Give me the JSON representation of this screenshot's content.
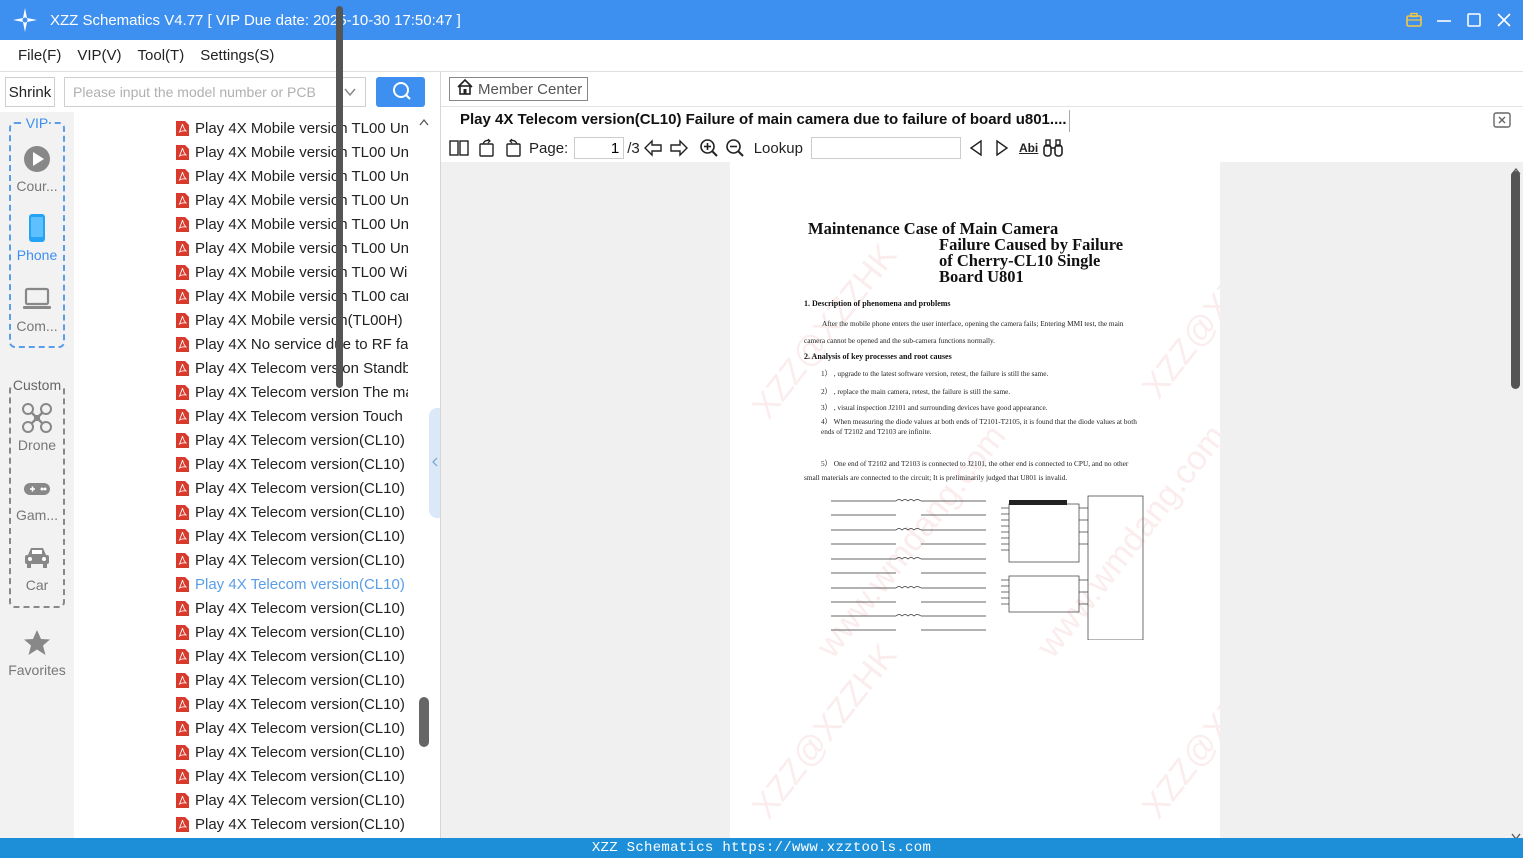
{
  "window": {
    "title": "XZZ Schematics V4.77 [ VIP Due date: 2025-10-30 17:50:47 ]"
  },
  "menu": [
    "File(F)",
    "VIP(V)",
    "Tool(T)",
    "Settings(S)"
  ],
  "toolbar": {
    "shrink_label": "Shrink",
    "search_placeholder": "Please input the model number or PCB"
  },
  "categories": {
    "vip_label": "VIP",
    "custom_label": "Custom",
    "items": [
      {
        "label": "Cour...",
        "icon": "play-circle-icon"
      },
      {
        "label": "Phone",
        "icon": "phone-icon",
        "active": true
      },
      {
        "label": "Com...",
        "icon": "laptop-icon"
      },
      {
        "label": "Drone",
        "icon": "drone-icon"
      },
      {
        "label": "Gam...",
        "icon": "gamepad-icon"
      },
      {
        "label": "Car",
        "icon": "car-icon"
      },
      {
        "label": "Favorites",
        "icon": "star-icon"
      }
    ]
  },
  "files": [
    "Play 4X Mobile version TL00 Un",
    "Play 4X Mobile version TL00 Un",
    "Play 4X Mobile version TL00 Un",
    "Play 4X Mobile version TL00 Un",
    "Play 4X Mobile version TL00 Un",
    "Play 4X Mobile version TL00 Un",
    "Play 4X Mobile version TL00 Wi",
    "Play 4X Mobile version TL00 car",
    "Play 4X Mobile version(TL00H) I",
    "Play 4X No service due to RF fai",
    "Play 4X Telecom version Standb",
    "Play 4X Telecom version The ma",
    "Play 4X Telecom version Touch",
    "Play 4X Telecom version(CL10) I",
    "Play 4X Telecom version(CL10) (",
    "Play 4X Telecom version(CL10) (",
    "Play 4X Telecom version(CL10) I",
    "Play 4X Telecom version(CL10) I",
    "Play 4X Telecom version(CL10) I",
    "Play 4X Telecom version(CL10) I",
    "Play 4X Telecom version(CL10) I",
    "Play 4X Telecom version(CL10) I",
    "Play 4X Telecom version(CL10) I",
    "Play 4X Telecom version(CL10) I",
    "Play 4X Telecom version(CL10) I",
    "Play 4X Telecom version(CL10) I",
    "Play 4X Telecom version(CL10) I",
    "Play 4X Telecom version(CL10) S",
    "Play 4X Telecom version(CL10) S",
    "Play 4X Telecom version(CL10) T"
  ],
  "selected_file_index": 19,
  "viewer": {
    "member_center": "Member Center",
    "doc_tab": "Play 4X Telecom version(CL10) Failure of main camera due to failure of board u801....",
    "page_label": "Page:",
    "page_current": "1",
    "page_total": "/3",
    "lookup_label": "Lookup",
    "abi_label": "Abi"
  },
  "document": {
    "title_lines": [
      "Maintenance Case of Main Camera",
      "Failure Caused by Failure",
      "of Cherry-CL10 Single",
      "Board U801"
    ],
    "section1": "1. Description of phenomena and problems",
    "para1": "After the mobile phone enters the user interface, opening the camera fails; Entering MMI test, the main camera cannot be opened and the sub-camera functions normally.",
    "section2": "2. Analysis of key processes and root causes",
    "steps": [
      "1） , upgrade to the latest software version, retest, the failure is still the same.",
      "2） , replace the main camera, retest, the failure is still the same.",
      "3） , visual inspection J2101 and surrounding devices have good appearance.",
      "4） When measuring the diode values at both ends of T2101-T2105, it is found that the diode values at both ends of T2102 and T2103 are infinite.",
      "5） One end of T2102 and T2103 is connected to J2101, the other end is connected to CPU, and no other small materials are connected to the circuit; It is preliminarily judged that U801 is invalid."
    ],
    "watermarks": [
      "XZZ@XZZHK",
      "www.wmdang.com"
    ]
  },
  "status": "XZZ Schematics https://www.xzztools.com",
  "colors": {
    "accent": "#3d8ff0",
    "status_bar": "#1c8fd8",
    "pdf_red": "#d93a2b",
    "selected_text": "#5a9de8"
  }
}
